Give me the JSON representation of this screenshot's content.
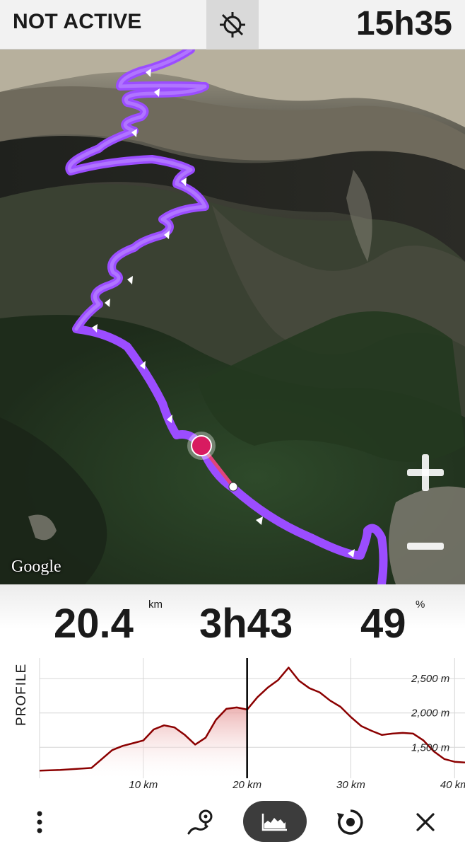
{
  "header": {
    "status": "NOT ACTIVE",
    "gps_icon": "gps-off-icon",
    "clock": "15h35"
  },
  "map": {
    "attribution": "Google",
    "zoom_in_icon": "plus-icon",
    "zoom_out_icon": "minus-icon",
    "track_color": "#9b4dff",
    "position_color": "#d81b60"
  },
  "stats": {
    "distance": "20.4",
    "distance_unit": "km",
    "time": "3h43",
    "progress": "49",
    "progress_unit": "%"
  },
  "profile": {
    "label": "PROFILE",
    "x_ticks": [
      "10 km",
      "20 km",
      "30 km",
      "40 km"
    ],
    "y_ticks": [
      "2,500 m",
      "2,000 m",
      "1,500 m"
    ],
    "line_color": "#8b0000"
  },
  "chart_data": {
    "type": "area",
    "xlabel": "",
    "ylabel": "",
    "x": [
      0,
      2,
      5,
      7,
      8,
      9,
      10,
      11,
      12,
      13,
      14,
      15,
      16,
      17,
      18,
      19,
      20,
      21,
      22,
      23,
      24,
      25,
      26,
      27,
      28,
      29,
      30,
      31,
      32,
      33,
      34,
      35,
      36,
      37,
      38,
      39,
      40,
      41
    ],
    "y": [
      1160,
      1170,
      1200,
      1460,
      1520,
      1560,
      1600,
      1760,
      1820,
      1790,
      1680,
      1540,
      1640,
      1900,
      2060,
      2080,
      2050,
      2230,
      2370,
      2480,
      2660,
      2470,
      2360,
      2300,
      2180,
      2090,
      1940,
      1810,
      1740,
      1680,
      1700,
      1710,
      1700,
      1600,
      1440,
      1330,
      1290,
      1280
    ],
    "current_x": 20,
    "xlim": [
      0,
      41
    ],
    "ylim": [
      1050,
      2800
    ],
    "x_ticks": [
      "10 km",
      "20 km",
      "30 km",
      "40 km"
    ],
    "y_ticks": [
      "2,500 m",
      "2,000 m",
      "1,500 m"
    ]
  },
  "toolbar": {
    "menu_icon": "more-vertical-icon",
    "route_icon": "route-pin-icon",
    "profile_icon": "elevation-profile-icon",
    "recenter_icon": "recenter-icon",
    "close_icon": "close-icon"
  }
}
